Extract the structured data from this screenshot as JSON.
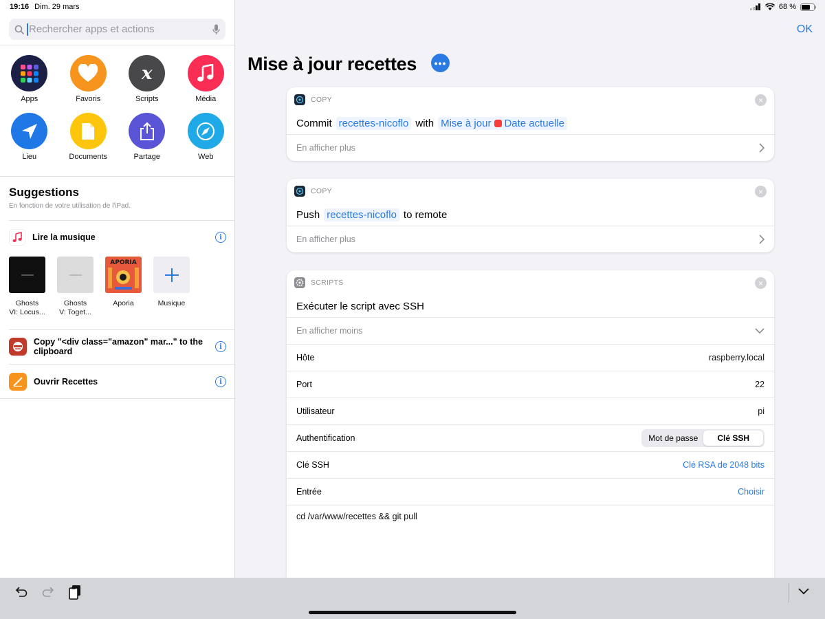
{
  "status": {
    "time": "19:16",
    "date": "Dim. 29 mars",
    "battery": "68 %"
  },
  "search": {
    "placeholder": "Rechercher apps et actions"
  },
  "categories": [
    {
      "label": "Apps",
      "color": "#1c2046",
      "icon": "apps-grid-icon"
    },
    {
      "label": "Favoris",
      "color": "#f7941d",
      "icon": "heart-icon"
    },
    {
      "label": "Scripts",
      "color": "#48484a",
      "icon": "variable-x-icon"
    },
    {
      "label": "Média",
      "color": "#fa2d55",
      "icon": "music-note-icon"
    },
    {
      "label": "Lieu",
      "color": "#1f78e6",
      "icon": "location-arrow-icon"
    },
    {
      "label": "Documents",
      "color": "#fdc60d",
      "icon": "document-icon"
    },
    {
      "label": "Partage",
      "color": "#5a55d6",
      "icon": "share-icon"
    },
    {
      "label": "Web",
      "color": "#1fa9e6",
      "icon": "compass-icon"
    }
  ],
  "suggestions": {
    "title": "Suggestions",
    "subtitle": "En fonction de votre utilisation de l'iPad.",
    "music": {
      "label": "Lire la musique",
      "albums": [
        {
          "line1": "Ghosts",
          "line2": "VI: Locus..."
        },
        {
          "line1": "Ghosts",
          "line2": "V: Toget..."
        },
        {
          "line1": "Aporia",
          "line2": ""
        },
        {
          "line1": "Musique",
          "line2": ""
        }
      ]
    },
    "copy": {
      "label": "Copy \"<div class=\"amazon\" mar...\" to the clipboard"
    },
    "recettes": {
      "label": "Ouvrir Recettes"
    }
  },
  "header": {
    "title": "Mise à jour recettes",
    "ok": "OK"
  },
  "cards": {
    "commit": {
      "category": "COPY",
      "word1": "Commit",
      "repo": "recettes-nicoflo",
      "with": "with",
      "msg": "Mise à jour",
      "date": "Date actuelle",
      "footer": "En afficher plus"
    },
    "push": {
      "category": "COPY",
      "word1": "Push",
      "repo": "recettes-nicoflo",
      "tail": "to remote",
      "footer": "En afficher plus"
    },
    "ssh": {
      "category": "SCRIPTS",
      "action": "Exécuter le script avec SSH",
      "footer": "En afficher moins",
      "fields": {
        "host": {
          "label": "Hôte",
          "value": "raspberry.local"
        },
        "port": {
          "label": "Port",
          "value": "22"
        },
        "user": {
          "label": "Utilisateur",
          "value": "pi"
        },
        "auth": {
          "label": "Authentification",
          "opt1": "Mot de passe",
          "opt2": "Clé SSH"
        },
        "key": {
          "label": "Clé SSH",
          "value": "Clé RSA de 2048 bits"
        },
        "input": {
          "label": "Entrée",
          "value": "Choisir"
        }
      },
      "script": "cd /var/www/recettes && git pull"
    }
  }
}
